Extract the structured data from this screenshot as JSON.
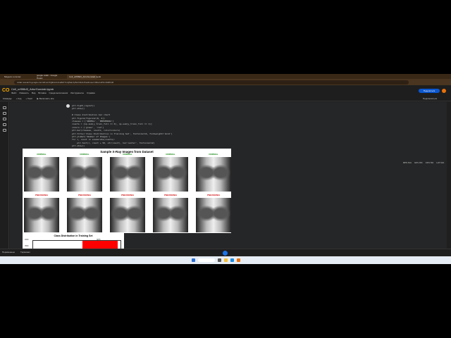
{
  "browser": {
    "tabs": [
      "Модели и соглас",
      "google colab - Google Поиск",
      "Cell_urf0f8d3_ArturGondaki.ipynb"
    ],
    "url": "colab.research.google.com/drive/1Xg9kL4mCe8sFTmQ5aLXp5wYAbcH?authuser=0#scrollTo=iAM6m8"
  },
  "colab": {
    "title": "Cell_urf0f8d3_ArturGondaki.ipynb",
    "menu": [
      "Файл",
      "Изменить",
      "Вид",
      "Вставка",
      "Среда выполнения",
      "Инструменты",
      "Справка"
    ],
    "share": "Поделиться",
    "avatar": "A"
  },
  "toolbar": {
    "items": [
      "Команды",
      "+ Код",
      "+ Текст",
      "▶ Выполнить все"
    ],
    "connect": "Подключиться"
  },
  "cell": {
    "counter": "[ ]",
    "code": "plt.tight_layout()\nplt.show()\n\n# Class distribution bar chart\nplt.figure(figsize=(6, 4))\nclasses = ['NORMAL', 'PNEUMONIA']\ncounts = [np.sum(y_train_full == 0), np.sum(y_train_full == 1)]\ncolors = ['green', 'red']\nplt.bar(classes, counts, color=colors)\nplt.title('Class Distribution in Training Set', fontsize=14, fontweight='bold')\nplt.ylabel('Number of Images')\nfor i, count in enumerate(counts):\n    plt.text(i, count + 50, str(count), ha='center', fontsize=12)\nplt.show()\n\nprint(f\"Class Imbalance: PNEUMONIA has {counts[1]/counts[0]:.2f}x more images than NORMAL\")"
  },
  "stats": [
    "RPS N/A",
    "GPU 0%",
    "CPU 6%",
    "LAT N/A"
  ],
  "figure": {
    "title": "Sample X-Ray Images from Dataset",
    "row1": "NORMAL",
    "row2": "PNEUMONIA",
    "normal_color": "#1a8a1a",
    "pneumonia_color": "#d01010"
  },
  "chart_preview": {
    "title": "Class Distribution in Training Set",
    "ticks": [
      "4000",
      "3500"
    ],
    "bar_label": "3875"
  },
  "status": {
    "variables": "Переменные",
    "terminal": "Терминал"
  }
}
